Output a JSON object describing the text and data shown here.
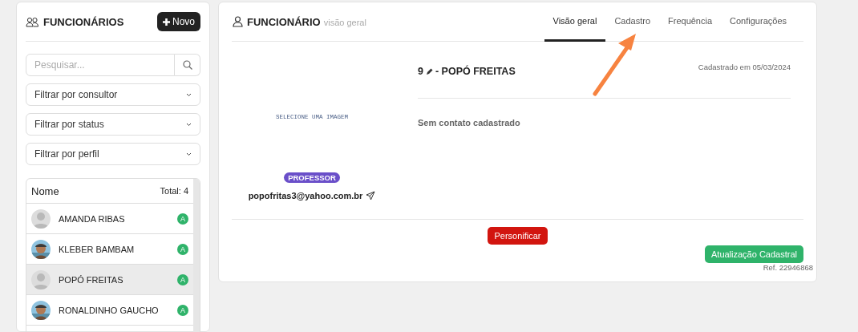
{
  "sidebar": {
    "title": "FUNCIONÁRIOS",
    "new_button": "Novo",
    "search": {
      "placeholder": "Pesquisar..."
    },
    "filters": [
      {
        "label": "Filtrar por consultor"
      },
      {
        "label": "Filtrar por status"
      },
      {
        "label": "Filtrar por perfil"
      }
    ],
    "list": {
      "column": "Nome",
      "total": "Total: 4",
      "items": [
        {
          "name": "AMANDA RIBAS",
          "badge": "A",
          "kind": "placeholder",
          "selected": false
        },
        {
          "name": "KLEBER BAMBAM",
          "badge": "A",
          "selected": false
        },
        {
          "name": "POPÓ FREITAS",
          "badge": "A",
          "kind": "placeholder",
          "selected": true
        },
        {
          "name": "RONALDINHO GAUCHO",
          "badge": "A",
          "selected": false
        }
      ]
    }
  },
  "main": {
    "title": "FUNCIONÁRIO",
    "subtitle": "visão geral",
    "tabs": [
      {
        "label": "Visão geral",
        "selected": true
      },
      {
        "label": "Cadastro",
        "selected": false
      },
      {
        "label": "Frequência",
        "selected": false
      },
      {
        "label": "Configurações",
        "selected": false
      }
    ],
    "image_hint": "SELECIONE UMA IMAGEM",
    "role": "PROFESSOR",
    "email": "popofritas3@yahoo.com.br",
    "employee_id": "9",
    "employee_name": "- POPÓ FREITAS",
    "registered": "Cadastrado em 05/03/2024",
    "contact": "Sem contato cadastrado",
    "impersonate_button": "Personificar",
    "update_button": "Atualização Cadastral",
    "ref": "Ref. 22946868"
  }
}
